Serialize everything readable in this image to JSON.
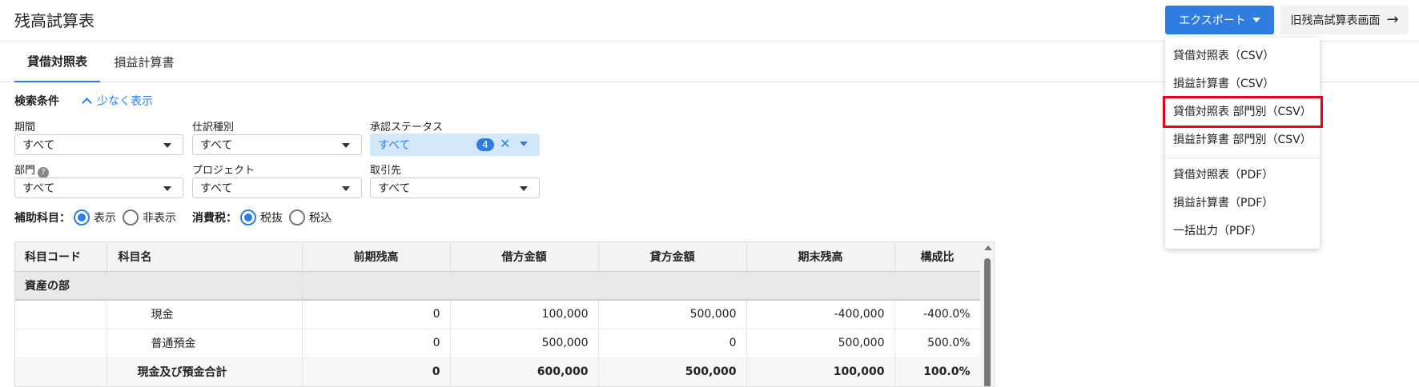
{
  "header": {
    "title": "残高試算表",
    "export_label": "エクスポート",
    "old_screen_label": "旧残高試算表画面"
  },
  "tabs": [
    {
      "label": "貸借対照表",
      "active": true
    },
    {
      "label": "損益計算書",
      "active": false
    }
  ],
  "filters": {
    "title": "検索条件",
    "toggle_label": "少なく表示",
    "period": {
      "label": "期間",
      "value": "すべて"
    },
    "journal_type": {
      "label": "仕訳種別",
      "value": "すべて"
    },
    "approval": {
      "label": "承認ステータス",
      "value": "すべて",
      "count": "4"
    },
    "department": {
      "label": "部門",
      "value": "すべて",
      "help": "?"
    },
    "project": {
      "label": "プロジェクト",
      "value": "すべて"
    },
    "partner": {
      "label": "取引先",
      "value": "すべて"
    },
    "sub_account": {
      "label": "補助科目：",
      "options": [
        "表示",
        "非表示"
      ],
      "selected": "表示"
    },
    "tax": {
      "label": "消費税：",
      "options": [
        "税抜",
        "税込"
      ],
      "selected": "税抜"
    }
  },
  "table": {
    "headers": [
      "科目コード",
      "科目名",
      "前期残高",
      "借方金額",
      "貸方金額",
      "期末残高",
      "構成比"
    ],
    "section_label": "資産の部",
    "rows": [
      {
        "code": "",
        "name": "現金",
        "prev": "0",
        "debit": "100,000",
        "credit": "500,000",
        "end": "-400,000",
        "ratio": "-400.0%"
      },
      {
        "code": "",
        "name": "普通預金",
        "prev": "0",
        "debit": "500,000",
        "credit": "0",
        "end": "500,000",
        "ratio": "500.0%"
      }
    ],
    "subtotal": {
      "name": "現金及び預金合計",
      "prev": "0",
      "debit": "600,000",
      "credit": "500,000",
      "end": "100,000",
      "ratio": "100.0%"
    }
  },
  "export_menu": {
    "items": [
      "貸借対照表（CSV）",
      "損益計算書（CSV）",
      "貸借対照表 部門別（CSV）",
      "損益計算書 部門別（CSV）",
      "貸借対照表（PDF）",
      "損益計算書（PDF）",
      "一括出力（PDF）"
    ],
    "highlighted_index": 2
  },
  "colors": {
    "accent": "#2f7de1",
    "highlight": "#e8001c",
    "selected_bg": "#d4e8fb"
  }
}
